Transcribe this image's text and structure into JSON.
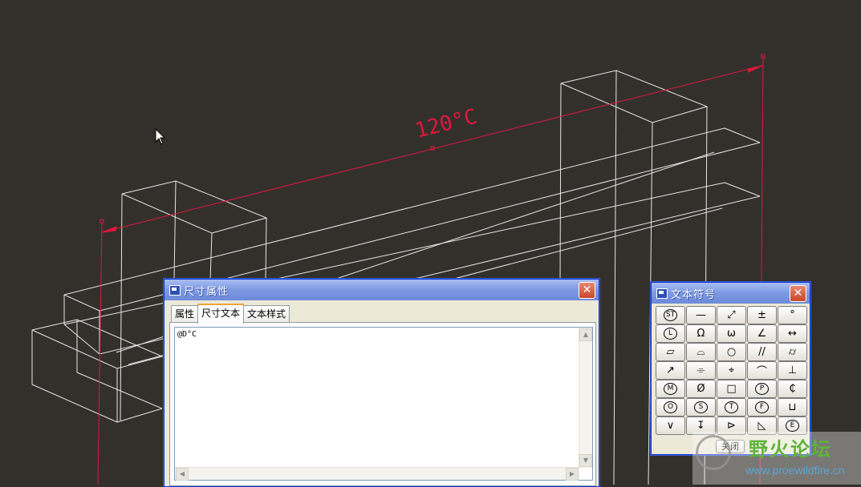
{
  "viewport": {
    "dimension_text": "120°C",
    "wire_color": "#e6e6e6",
    "dim_color": "#e0173a",
    "background": "#33302c"
  },
  "dim_dialog": {
    "title": "尺寸属性",
    "tabs": [
      "属性",
      "尺寸文本",
      "文本样式"
    ],
    "active_tab": "尺寸文本",
    "text_value": "@D°C",
    "close_label": "✕"
  },
  "symbols_dialog": {
    "title": "文本符号",
    "close_label": "✕",
    "close_button_label": "关闭",
    "symbols": [
      {
        "glyph": "ST",
        "circled": true,
        "icon": "statistical-tolerance-icon"
      },
      {
        "glyph": "—",
        "icon": "straightness-icon"
      },
      {
        "glyph": "⤢",
        "icon": "total-runout-icon"
      },
      {
        "glyph": "±",
        "icon": "plus-minus-icon"
      },
      {
        "glyph": "°",
        "icon": "degree-icon"
      },
      {
        "glyph": "L",
        "circled": true,
        "icon": "least-material-icon"
      },
      {
        "glyph": "Ω",
        "icon": "omega-icon"
      },
      {
        "glyph": "ω",
        "icon": "small-omega-icon"
      },
      {
        "glyph": "∠",
        "icon": "angularity-icon"
      },
      {
        "glyph": "↔",
        "icon": "between-icon"
      },
      {
        "glyph": "▱",
        "icon": "flatness-icon"
      },
      {
        "glyph": "⌓",
        "icon": "surface-profile-icon"
      },
      {
        "glyph": "○",
        "icon": "circularity-icon"
      },
      {
        "glyph": "//",
        "icon": "parallelism-icon"
      },
      {
        "glyph": "⌭",
        "icon": "cylindricity-icon"
      },
      {
        "glyph": "↗",
        "icon": "circular-runout-icon"
      },
      {
        "glyph": "⌯",
        "icon": "symmetry-icon"
      },
      {
        "glyph": "⌖",
        "icon": "position-icon"
      },
      {
        "glyph": "⌒",
        "icon": "line-profile-icon"
      },
      {
        "glyph": "⊥",
        "icon": "perpendicularity-icon"
      },
      {
        "glyph": "M",
        "circled": true,
        "icon": "max-material-icon"
      },
      {
        "glyph": "Ø",
        "icon": "diameter-icon"
      },
      {
        "glyph": "□",
        "icon": "square-icon"
      },
      {
        "glyph": "P",
        "circled": true,
        "icon": "projected-zone-icon"
      },
      {
        "glyph": "₵",
        "icon": "centerline-icon"
      },
      {
        "glyph": "O",
        "circled": true,
        "icon": "concentricity-icon"
      },
      {
        "glyph": "S",
        "circled": true,
        "icon": "regardless-size-icon"
      },
      {
        "glyph": "T",
        "circled": true,
        "icon": "tangent-plane-icon"
      },
      {
        "glyph": "F",
        "circled": true,
        "icon": "free-state-icon"
      },
      {
        "glyph": "⊔",
        "icon": "counterbore-icon"
      },
      {
        "glyph": "∨",
        "icon": "countersink-icon"
      },
      {
        "glyph": "↧",
        "icon": "depth-icon"
      },
      {
        "glyph": "⊳",
        "icon": "conical-taper-icon"
      },
      {
        "glyph": "◺",
        "icon": "slope-icon"
      },
      {
        "glyph": "E",
        "circled": true,
        "icon": "envelope-icon"
      }
    ]
  },
  "watermark": {
    "title": "野火论坛",
    "url": "www.proewildfire.cn"
  }
}
